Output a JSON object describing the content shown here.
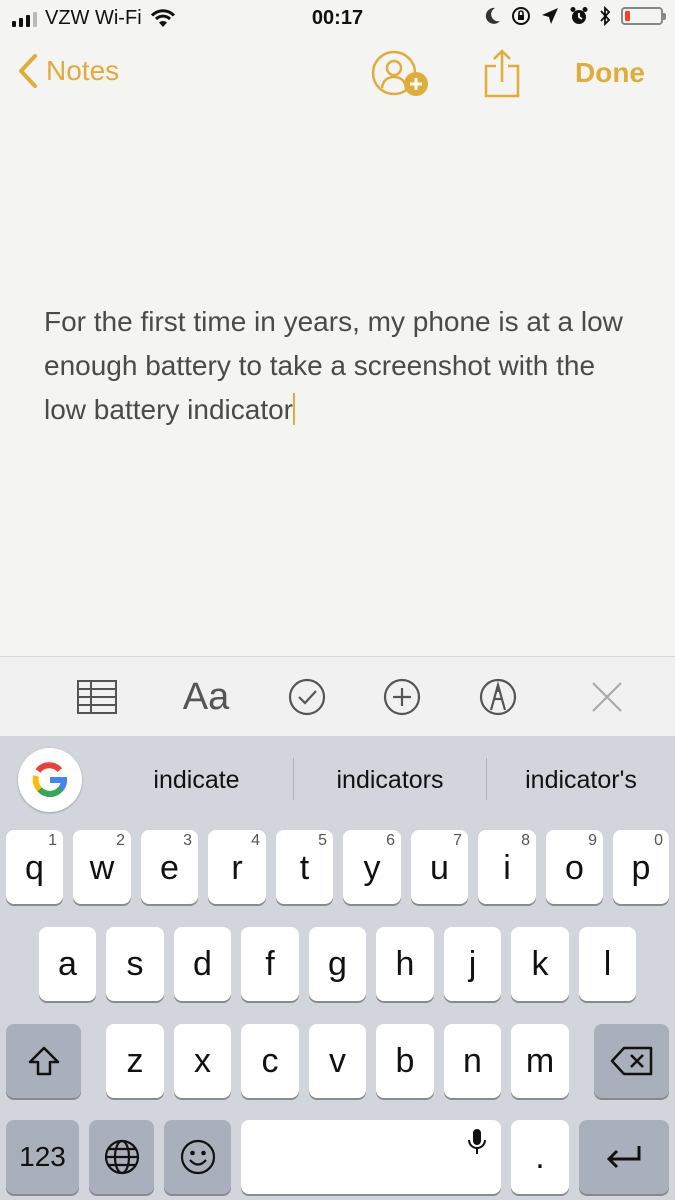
{
  "status_bar": {
    "carrier": "VZW Wi-Fi",
    "time": "00:17",
    "battery_level": 0.15,
    "battery_color": "#ff3b30"
  },
  "nav": {
    "back_label": "Notes",
    "done_label": "Done",
    "accent_color": "#e0ac3a"
  },
  "note": {
    "text": "For the first time in years, my phone is at a low enough battery to take a screenshot with the low battery indicator"
  },
  "toolbar": {
    "format_label": "Aa",
    "icons": [
      "table-icon",
      "text-format-icon",
      "checklist-icon",
      "add-icon",
      "markup-icon",
      "close-icon"
    ]
  },
  "keyboard": {
    "suggestions": [
      "indicate",
      "indicators",
      "indicator's"
    ],
    "row1": [
      {
        "letter": "q",
        "num": "1"
      },
      {
        "letter": "w",
        "num": "2"
      },
      {
        "letter": "e",
        "num": "3"
      },
      {
        "letter": "r",
        "num": "4"
      },
      {
        "letter": "t",
        "num": "5"
      },
      {
        "letter": "y",
        "num": "6"
      },
      {
        "letter": "u",
        "num": "7"
      },
      {
        "letter": "i",
        "num": "8"
      },
      {
        "letter": "o",
        "num": "9"
      },
      {
        "letter": "p",
        "num": "0"
      }
    ],
    "row2": [
      "a",
      "s",
      "d",
      "f",
      "g",
      "h",
      "j",
      "k",
      "l"
    ],
    "row3": [
      "z",
      "x",
      "c",
      "v",
      "b",
      "n",
      "m"
    ],
    "numbers_label": "123",
    "period_label": "."
  }
}
